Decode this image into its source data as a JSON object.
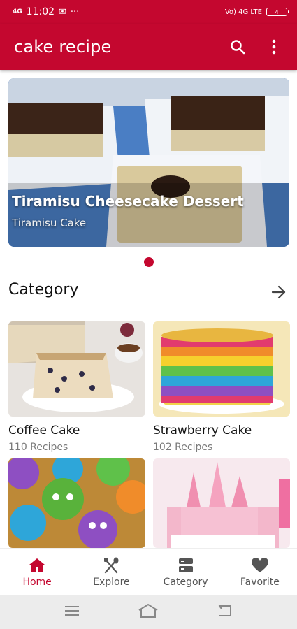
{
  "status": {
    "time": "11:02",
    "left_badge": "4G",
    "right_badge": "Vo) 4G LTE",
    "battery": "4"
  },
  "app": {
    "title": "cake recipe",
    "accent": "#c4072f"
  },
  "banner": {
    "title": "Tiramisu Cheesecake Dessert",
    "subtitle": "Tiramisu Cake"
  },
  "section": {
    "title": "Category"
  },
  "categories": [
    {
      "name": "Coffee Cake",
      "count": "110 Recipes"
    },
    {
      "name": "Strawberry Cake",
      "count": "102 Recipes"
    },
    {
      "name": "",
      "count": ""
    },
    {
      "name": "",
      "count": ""
    }
  ],
  "nav": [
    {
      "label": "Home",
      "icon": "home-icon",
      "active": true
    },
    {
      "label": "Explore",
      "icon": "fork-knife-icon",
      "active": false
    },
    {
      "label": "Category",
      "icon": "category-icon",
      "active": false
    },
    {
      "label": "Favorite",
      "icon": "heart-icon",
      "active": false
    }
  ]
}
